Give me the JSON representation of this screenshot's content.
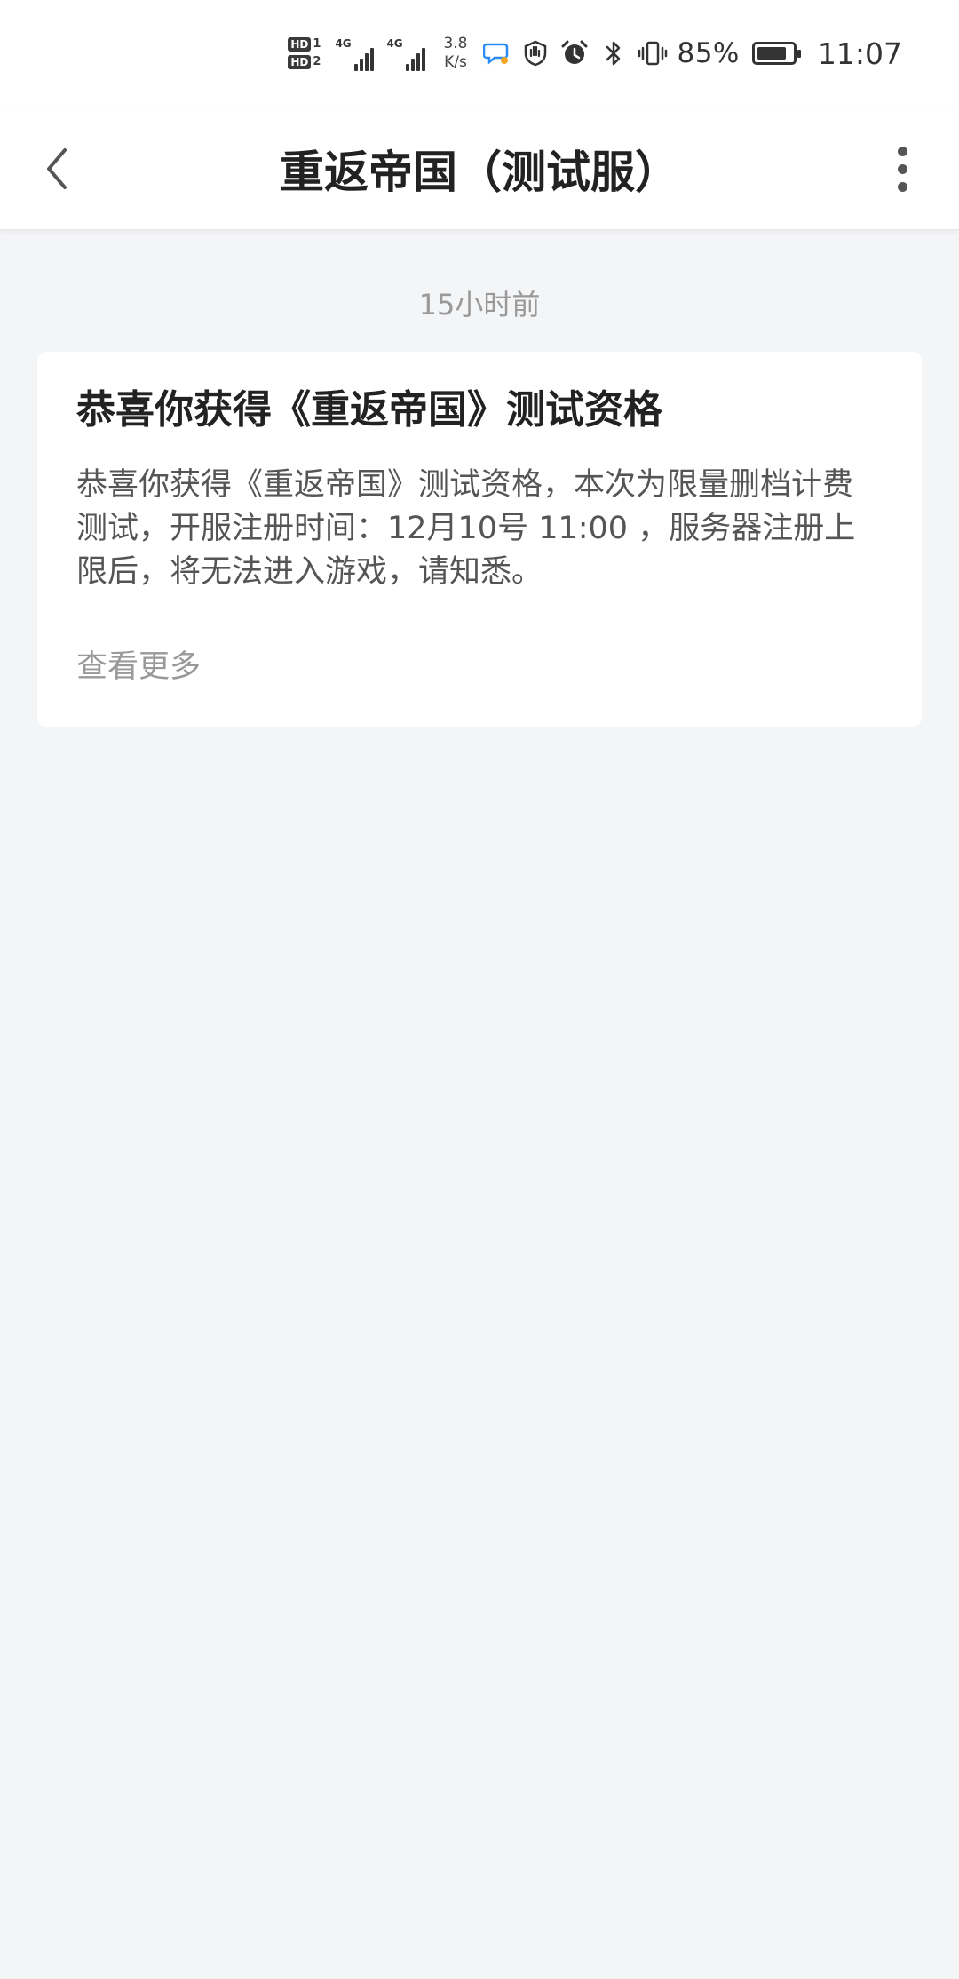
{
  "status_bar": {
    "sim1_label": "HD",
    "sim1_index": "1",
    "sim2_label": "HD",
    "sim2_index": "2",
    "signal1_label": "4G",
    "signal2_label": "4G",
    "net_speed_value": "3.8",
    "net_speed_unit": "K/s",
    "battery_percent": "85%",
    "battery_level": 0.85,
    "time": "11:07",
    "icons": [
      "chat-bubble-icon",
      "hand-shield-icon",
      "alarm-icon",
      "bluetooth-icon",
      "vibrate-icon",
      "battery-icon"
    ]
  },
  "nav": {
    "title": "重返帝国（测试服）",
    "back_icon": "chevron-left-icon",
    "more_icon": "more-vertical-icon"
  },
  "message": {
    "timestamp": "15小时前",
    "title": "恭喜你获得《重返帝国》测试资格",
    "body": "恭喜你获得《重返帝国》测试资格，本次为限量删档计费测试，开服注册时间：12月10号 11:00 ，服务器注册上限后，将无法进入游戏，请知悉。",
    "more_label": "查看更多"
  },
  "colors": {
    "page_background": "#f4f5f7",
    "card_background": "#ffffff",
    "title_text": "#222222",
    "body_text": "#555555",
    "muted_text": "#999999"
  }
}
